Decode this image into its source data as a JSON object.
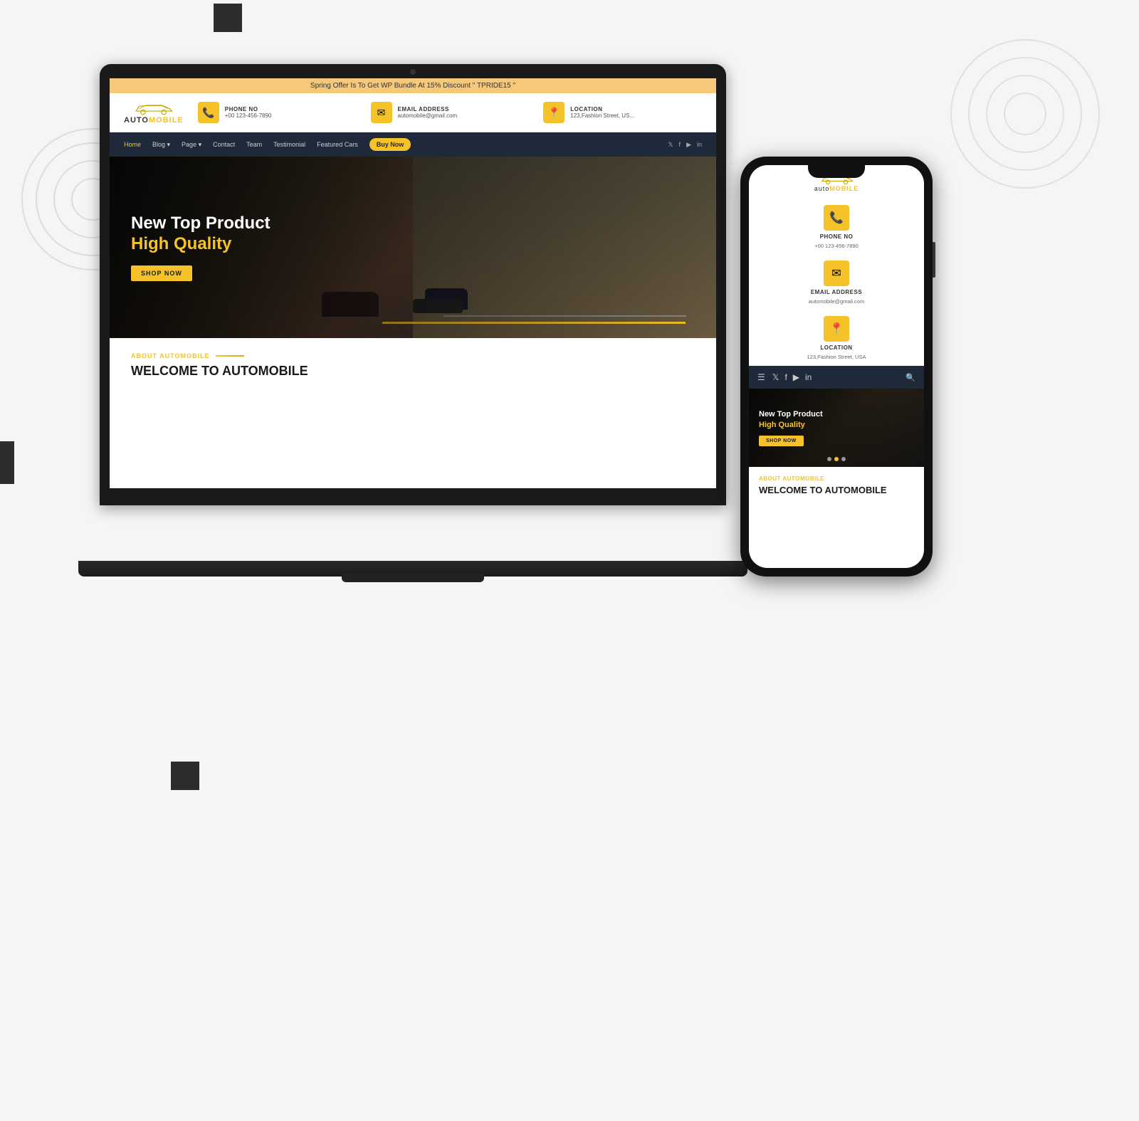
{
  "background": {
    "color": "#f5f5f5"
  },
  "laptop": {
    "banner": "Spring Offer Is To Get WP Bundle At 15% Discount \" TPRIDE15 \"",
    "logo": {
      "text_auto": "auto",
      "text_mobile": "MOBILE"
    },
    "contact": {
      "phone": {
        "label": "PHONE NO",
        "value": "+00 123-456-7890"
      },
      "email": {
        "label": "EMAIL ADDRESS",
        "value": "automobile@gmail.com"
      },
      "location": {
        "label": "LOCATION",
        "value": "123,Fashion Street, US..."
      }
    },
    "nav": {
      "items": [
        "Home",
        "Blog",
        "Page",
        "Contact",
        "Team",
        "Testimonial",
        "Featured Cars"
      ],
      "buy_label": "Buy Now",
      "social": [
        "𝕏",
        "f",
        "▶",
        "in"
      ]
    },
    "hero": {
      "line1": "New Top Product",
      "line2_prefix": "High ",
      "line2_highlight": "Quality",
      "cta": "SHOP NOW"
    },
    "about": {
      "label": "ABOUT AUTOMOBILE",
      "title": "WELCOME TO AUTOMOBILE"
    }
  },
  "phone": {
    "logo": {
      "text_auto": "auto",
      "text_mobile": "MOBILE"
    },
    "contact": {
      "phone": {
        "label": "PHONE NO",
        "value": "+00 123-456-7890"
      },
      "email": {
        "label": "EMAIL ADDRESS",
        "value": "automobile@gmail.com"
      },
      "location": {
        "label": "LOCATION",
        "value": "123,Fashion Street, USA"
      }
    },
    "hero": {
      "line1": "New Top Product",
      "line2_prefix": "High ",
      "line2_highlight": "Quality",
      "cta": "SHOP NOW",
      "dots": 3,
      "active_dot": 1
    },
    "about": {
      "label": "ABOUT AUTOMOBILE",
      "title": "WELCOME TO AUTOMOBILE"
    },
    "nav": {
      "social": [
        "f",
        "▶",
        "in"
      ]
    }
  }
}
